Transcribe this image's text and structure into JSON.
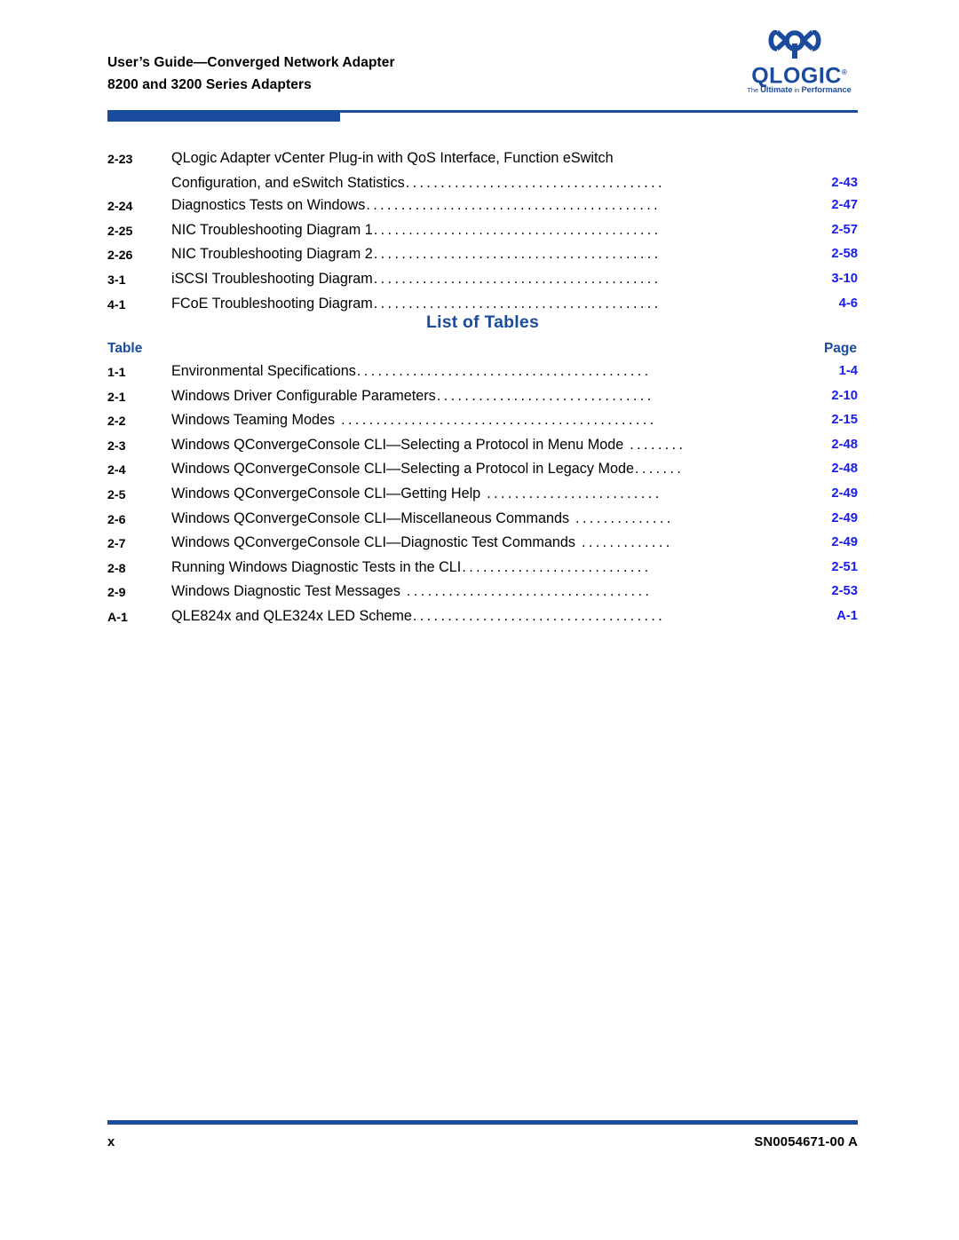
{
  "header": {
    "line1": "User’s Guide—Converged Network Adapter",
    "line2": "8200 and 3200 Series Adapters",
    "logo_word": "QLOGIC",
    "logo_reg": "®",
    "logo_tagline_the": "The ",
    "logo_tagline_ultimate": "Ultimate",
    "logo_tagline_in": " in ",
    "logo_tagline_performance": "Performance"
  },
  "colors": {
    "brand_blue": "#1b4b9c",
    "link_blue": "#1b1bef",
    "text_black": "#000000"
  },
  "figures_continued": {
    "rows": [
      {
        "num": "2-23",
        "line1": "QLogic Adapter vCenter Plug-in with QoS Interface, Function eSwitch",
        "line2": "Configuration, and eSwitch Statistics",
        "leader": ".....................................",
        "page": "2-43"
      },
      {
        "num": "2-24",
        "label": "Diagnostics Tests on Windows",
        "leader": "..........................................",
        "page": "2-47"
      },
      {
        "num": "2-25",
        "label": "NIC Troubleshooting Diagram 1",
        "leader": ".........................................",
        "page": "2-57"
      },
      {
        "num": "2-26",
        "label": "NIC Troubleshooting Diagram 2",
        "leader": ".........................................",
        "page": "2-58"
      },
      {
        "num": "3-1",
        "label": "iSCSI Troubleshooting Diagram",
        "leader": ".........................................",
        "page": "3-10"
      },
      {
        "num": "4-1",
        "label": "FCoE Troubleshooting Diagram",
        "leader": ".........................................",
        "page": "4-6"
      }
    ]
  },
  "list_of_tables": {
    "title": "List of Tables",
    "col_table": "Table",
    "col_page": "Page",
    "rows": [
      {
        "num": "1-1",
        "label": "Environmental Specifications",
        "leader": "..........................................",
        "page": "1-4"
      },
      {
        "num": "2-1",
        "label": "Windows Driver Configurable Parameters",
        "leader": "...............................",
        "page": "2-10"
      },
      {
        "num": "2-2",
        "label": "Windows Teaming Modes",
        "leader": ".............................................",
        "page": "2-15",
        "gap": true
      },
      {
        "num": "2-3",
        "label": "Windows QConvergeConsole CLI—Selecting a Protocol in Menu Mode",
        "leader": "........",
        "page": "2-48",
        "gap": true
      },
      {
        "num": "2-4",
        "label": "Windows QConvergeConsole CLI—Selecting a Protocol in Legacy Mode",
        "leader": ".......",
        "page": "2-48"
      },
      {
        "num": "2-5",
        "label": "Windows QConvergeConsole CLI—Getting Help",
        "leader": ".........................",
        "page": "2-49",
        "gap": true
      },
      {
        "num": "2-6",
        "label": "Windows QConvergeConsole CLI—Miscellaneous Commands",
        "leader": "..............",
        "page": "2-49",
        "gap": true
      },
      {
        "num": "2-7",
        "label": "Windows QConvergeConsole CLI—Diagnostic Test Commands",
        "leader": ".............",
        "page": "2-49",
        "gap": true
      },
      {
        "num": "2-8",
        "label": "Running Windows Diagnostic Tests in the CLI",
        "leader": "...........................",
        "page": "2-51"
      },
      {
        "num": "2-9",
        "label": "Windows Diagnostic Test Messages",
        "leader": "...................................",
        "page": "2-53",
        "gap": true
      },
      {
        "num": "A-1",
        "label": "QLE824x and QLE324x LED Scheme",
        "leader": "....................................",
        "page": "A-1"
      }
    ]
  },
  "footer": {
    "page_number": "x",
    "doc_number": "SN0054671-00  A"
  }
}
